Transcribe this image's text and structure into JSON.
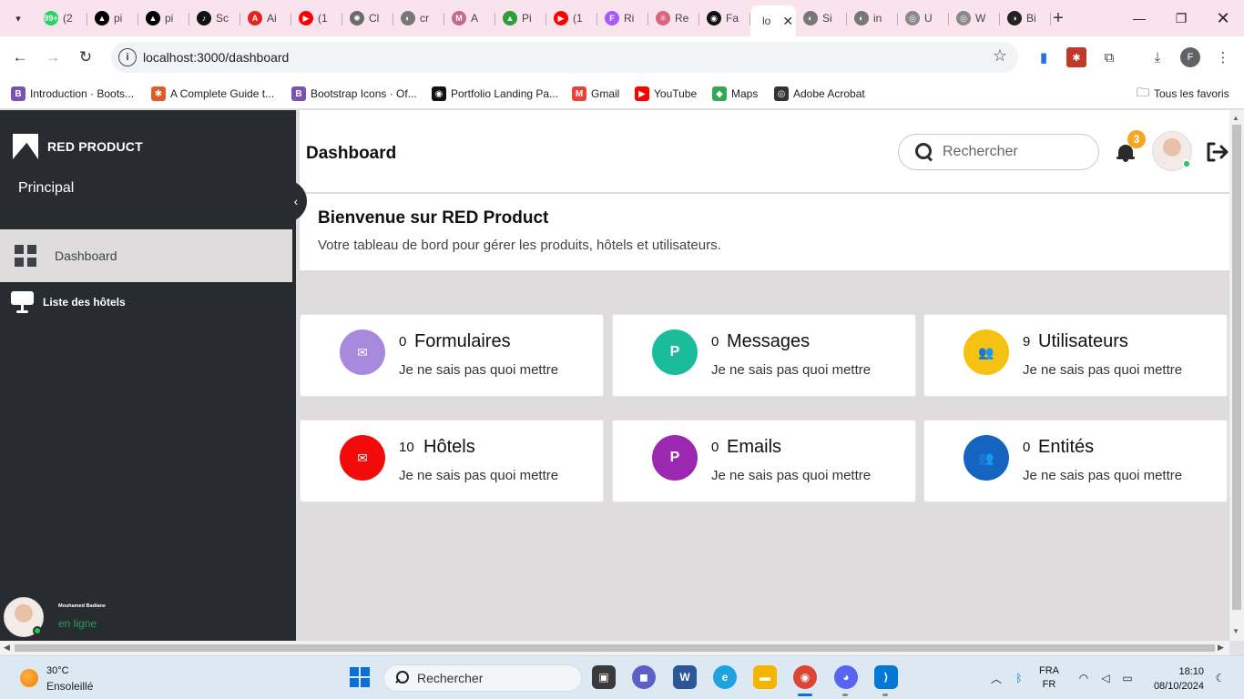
{
  "browser": {
    "tabs": [
      {
        "label": "(2",
        "color": "#25d366",
        "glyph": "99+"
      },
      {
        "label": "pi",
        "color": "#000000",
        "glyph": "▲"
      },
      {
        "label": "pi",
        "color": "#000000",
        "glyph": "▲"
      },
      {
        "label": "Sc",
        "color": "#111111",
        "glyph": "♪"
      },
      {
        "label": "Ai",
        "color": "#e3251f",
        "glyph": "A"
      },
      {
        "label": "(1",
        "color": "#ff0000",
        "glyph": "▶"
      },
      {
        "label": "Cl",
        "color": "#6b6b6b",
        "glyph": "✺"
      },
      {
        "label": "cr",
        "color": "#777777",
        "glyph": "◐"
      },
      {
        "label": "A",
        "color": "#c46a8c",
        "glyph": "M"
      },
      {
        "label": "Pi",
        "color": "#2d9d3a",
        "glyph": "▲"
      },
      {
        "label": "(1",
        "color": "#ff0000",
        "glyph": "▶"
      },
      {
        "label": "Ri",
        "color": "#a259ff",
        "glyph": "F"
      },
      {
        "label": "Re",
        "color": "#d9667e",
        "glyph": "⚛"
      },
      {
        "label": "Fa",
        "color": "#111111",
        "glyph": "◉"
      },
      {
        "label": "lo",
        "color": "#ffffff",
        "glyph": "",
        "active": true
      },
      {
        "label": "Si",
        "color": "#777777",
        "glyph": "◐"
      },
      {
        "label": "in",
        "color": "#777777",
        "glyph": "◐"
      },
      {
        "label": "U",
        "color": "#8a8a8a",
        "glyph": "◎"
      },
      {
        "label": "W",
        "color": "#8a8a8a",
        "glyph": "◎"
      },
      {
        "label": "Bi",
        "color": "#222222",
        "glyph": "◑"
      }
    ],
    "url": "localhost:3000/dashboard",
    "profile_initial": "F",
    "bookmarks": [
      {
        "label": "Introduction · Boots...",
        "icon_color": "#7952b3",
        "glyph": "B"
      },
      {
        "label": "A Complete Guide t...",
        "icon_color": "#e25b2c",
        "glyph": "✱"
      },
      {
        "label": "Bootstrap Icons · Of...",
        "icon_color": "#7952b3",
        "glyph": "B"
      },
      {
        "label": "Portfolio Landing Pa...",
        "icon_color": "#111111",
        "glyph": "◉"
      },
      {
        "label": "Gmail",
        "icon_color": "#ea4335",
        "glyph": "M"
      },
      {
        "label": "YouTube",
        "icon_color": "#ff0000",
        "glyph": "▶"
      },
      {
        "label": "Maps",
        "icon_color": "#34a853",
        "glyph": "◆"
      },
      {
        "label": "Adobe Acrobat",
        "icon_color": "#333333",
        "glyph": "◎"
      }
    ],
    "all_bookmarks_label": "Tous les favoris"
  },
  "sidebar": {
    "brand": "RED PRODUCT",
    "section": "Principal",
    "items": [
      {
        "label": "Dashboard",
        "active": true
      },
      {
        "label": "Liste des hôtels",
        "active": false
      }
    ],
    "user": {
      "name": "Mouhamed Badiane",
      "status": "en ligne"
    }
  },
  "header": {
    "title": "Dashboard",
    "search_placeholder": "Rechercher",
    "notification_count": "3"
  },
  "welcome": {
    "title": "Bienvenue sur RED Product",
    "subtitle": "Votre tableau de bord pour gérer les produits, hôtels et utilisateurs."
  },
  "cards": [
    {
      "count": "0",
      "name": "Formulaires",
      "desc": "Je ne sais pas quoi mettre",
      "color": "#a88add",
      "glyph": "✉"
    },
    {
      "count": "0",
      "name": "Messages",
      "desc": "Je ne sais pas quoi mettre",
      "color": "#1abc9c",
      "glyph": "P"
    },
    {
      "count": "9",
      "name": "Utilisateurs",
      "desc": "Je ne sais pas quoi mettre",
      "color": "#f5c211",
      "glyph": "👥"
    },
    {
      "count": "10",
      "name": "Hôtels",
      "desc": "Je ne sais pas quoi mettre",
      "color": "#f30b0b",
      "glyph": "✉"
    },
    {
      "count": "0",
      "name": "Emails",
      "desc": "Je ne sais pas quoi mettre",
      "color": "#9c27b0",
      "glyph": "P"
    },
    {
      "count": "0",
      "name": "Entités",
      "desc": "Je ne sais pas quoi mettre",
      "color": "#1565c0",
      "glyph": "👥"
    }
  ],
  "taskbar": {
    "temperature": "30°C",
    "weather": "Ensoleillé",
    "search": "Rechercher",
    "lang_top": "FRA",
    "lang_bottom": "FR",
    "time": "18:10",
    "date": "08/10/2024"
  }
}
